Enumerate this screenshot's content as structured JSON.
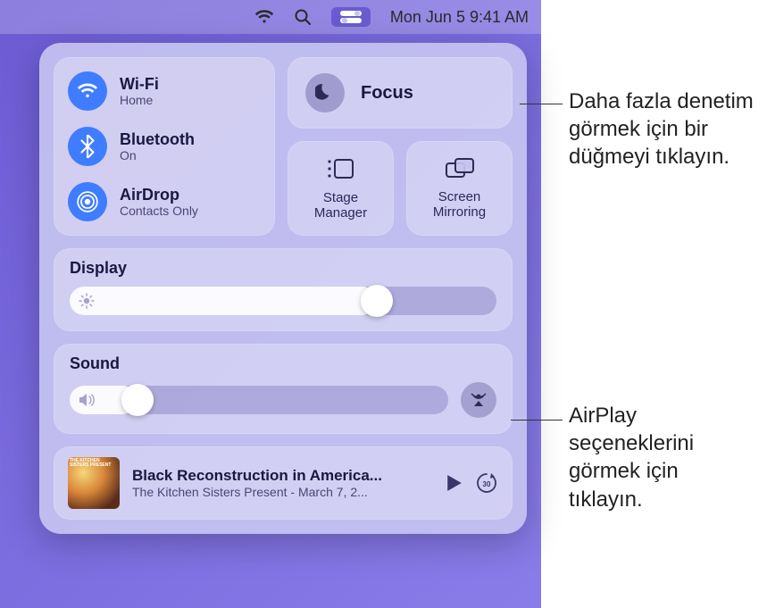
{
  "menubar": {
    "datetime": "Mon Jun 5  9:41 AM"
  },
  "connectivity": {
    "wifi": {
      "title": "Wi-Fi",
      "sub": "Home"
    },
    "bluetooth": {
      "title": "Bluetooth",
      "sub": "On"
    },
    "airdrop": {
      "title": "AirDrop",
      "sub": "Contacts Only"
    }
  },
  "focus": {
    "label": "Focus"
  },
  "stage": {
    "label": "Stage\nManager"
  },
  "mirror": {
    "label": "Screen\nMirroring"
  },
  "display": {
    "title": "Display",
    "value_pct": 72
  },
  "sound": {
    "title": "Sound",
    "value_pct": 18
  },
  "nowplaying": {
    "title": "Black Reconstruction in America...",
    "subtitle": "The Kitchen Sisters Present - March 7, 2...",
    "artwork_caption": "THE KITCHEN SISTERS PRESENT"
  },
  "callouts": {
    "focus": "Daha fazla denetim görmek için bir düğmeyi tıklayın.",
    "airplay": "AirPlay seçeneklerini görmek için tıklayın."
  },
  "colors": {
    "accent_blue": "#3f7cff"
  }
}
